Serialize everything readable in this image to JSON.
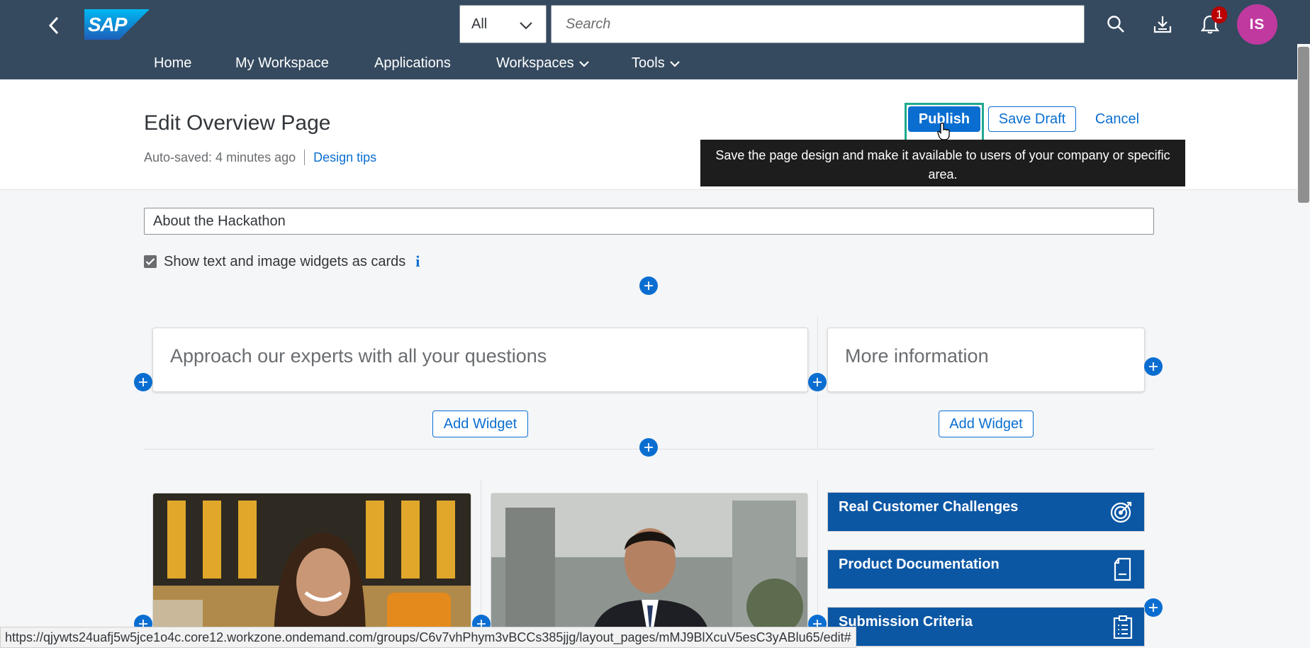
{
  "shell": {
    "back_icon": "chevron-left-icon",
    "logo_text": "SAP",
    "scope_select": "All",
    "search_placeholder": "Search",
    "icons": [
      "search-icon",
      "download-icon",
      "notification-bell-icon"
    ],
    "notification_count": "1",
    "avatar_initials": "IS",
    "avatar_color": "#c0399f",
    "bar_color": "#354a5f"
  },
  "nav": {
    "items": [
      {
        "label": "Home"
      },
      {
        "label": "My Workspace"
      },
      {
        "label": "Applications"
      },
      {
        "label": "Workspaces",
        "dropdown": true
      },
      {
        "label": "Tools",
        "dropdown": true
      }
    ]
  },
  "header": {
    "title": "Edit Overview Page",
    "autosave": "Auto-saved: 4 minutes ago",
    "design_tips": "Design tips",
    "publish_label": "Publish",
    "save_draft_label": "Save Draft",
    "cancel_label": "Cancel",
    "tooltip": "Save the page design and make it available to users of your company or specific area."
  },
  "content": {
    "section_name": "About the Hackathon",
    "show_cards_label": "Show text and image widgets as cards",
    "show_cards_checked": true,
    "card_left_title": "Approach our experts with all your questions",
    "card_right_title": "More information",
    "add_widget_label": "Add Widget",
    "links": [
      {
        "label": "Real Customer Challenges",
        "icon": "target-icon"
      },
      {
        "label": "Product Documentation",
        "icon": "document-icon"
      },
      {
        "label": "Submission Criteria",
        "icon": "clipboard-icon"
      }
    ],
    "accent_color": "#0a6ed1",
    "tile_color": "#0b57a4"
  },
  "status_bar": {
    "url": "https://qjywts24uafj5w5jce1o4c.core12.workzone.ondemand.com/groups/C6v7vhPhym3vBCCs385jjg/layout_pages/mMJ9BlXcuV5esC3yABlu65/edit#"
  }
}
